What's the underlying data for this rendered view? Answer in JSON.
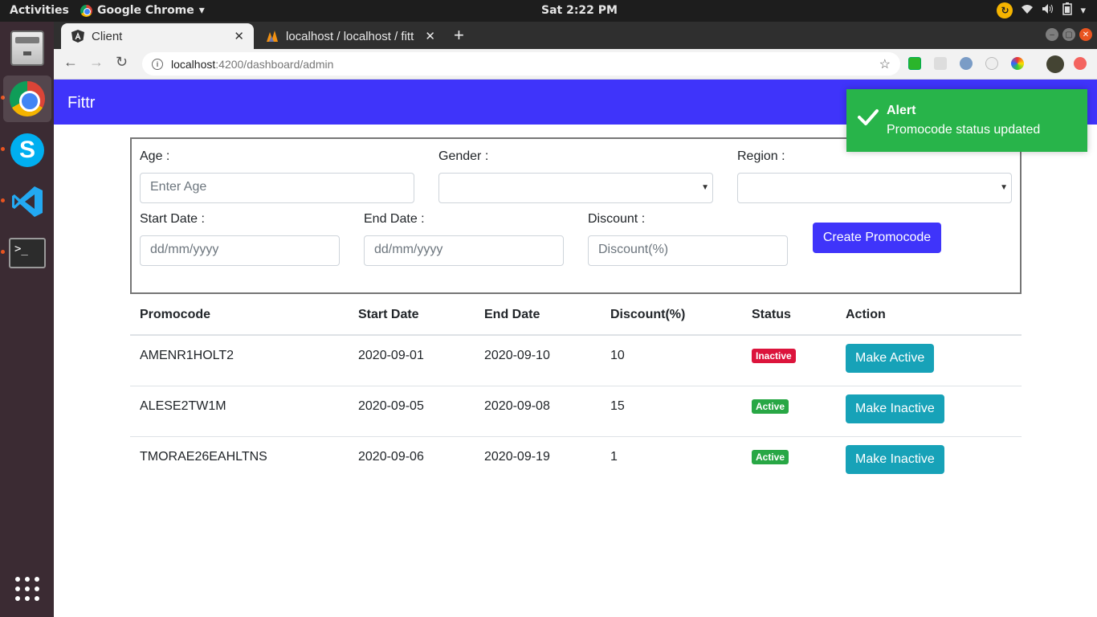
{
  "system": {
    "activities": "Activities",
    "app_name": "Google Chrome",
    "clock": "Sat  2:22 PM"
  },
  "browser": {
    "tabs": [
      {
        "title": "Client",
        "icon": "angular-icon"
      },
      {
        "title": "localhost / localhost / fitt",
        "icon": "phpmyadmin-icon"
      }
    ],
    "url_host": "localhost",
    "url_path": ":4200/dashboard/admin"
  },
  "app": {
    "brand": "Fittr",
    "form": {
      "age_label": "Age :",
      "age_placeholder": "Enter Age",
      "gender_label": "Gender :",
      "region_label": "Region :",
      "start_label": "Start Date :",
      "start_placeholder": "dd/mm/yyyy",
      "end_label": "End Date :",
      "end_placeholder": "dd/mm/yyyy",
      "discount_label": "Discount :",
      "discount_placeholder": "Discount(%)",
      "create_button": "Create Promocode"
    },
    "table": {
      "headers": [
        "Promocode",
        "Start Date",
        "End Date",
        "Discount(%)",
        "Status",
        "Action"
      ],
      "rows": [
        {
          "code": "AMENR1HOLT2",
          "start": "2020-09-01",
          "end": "2020-09-10",
          "discount": "10",
          "status": "Inactive",
          "action": "Make Active"
        },
        {
          "code": "ALESE2TW1M",
          "start": "2020-09-05",
          "end": "2020-09-08",
          "discount": "15",
          "status": "Active",
          "action": "Make Inactive"
        },
        {
          "code": "TMORAE26EAHLTNS",
          "start": "2020-09-06",
          "end": "2020-09-19",
          "discount": "1",
          "status": "Active",
          "action": "Make Inactive"
        }
      ]
    },
    "toast": {
      "title": "Alert",
      "message": "Promocode status updated"
    }
  },
  "colors": {
    "brand": "#3f34fa",
    "success": "#28b44a",
    "danger": "#dc143c",
    "info": "#17a2b8"
  }
}
